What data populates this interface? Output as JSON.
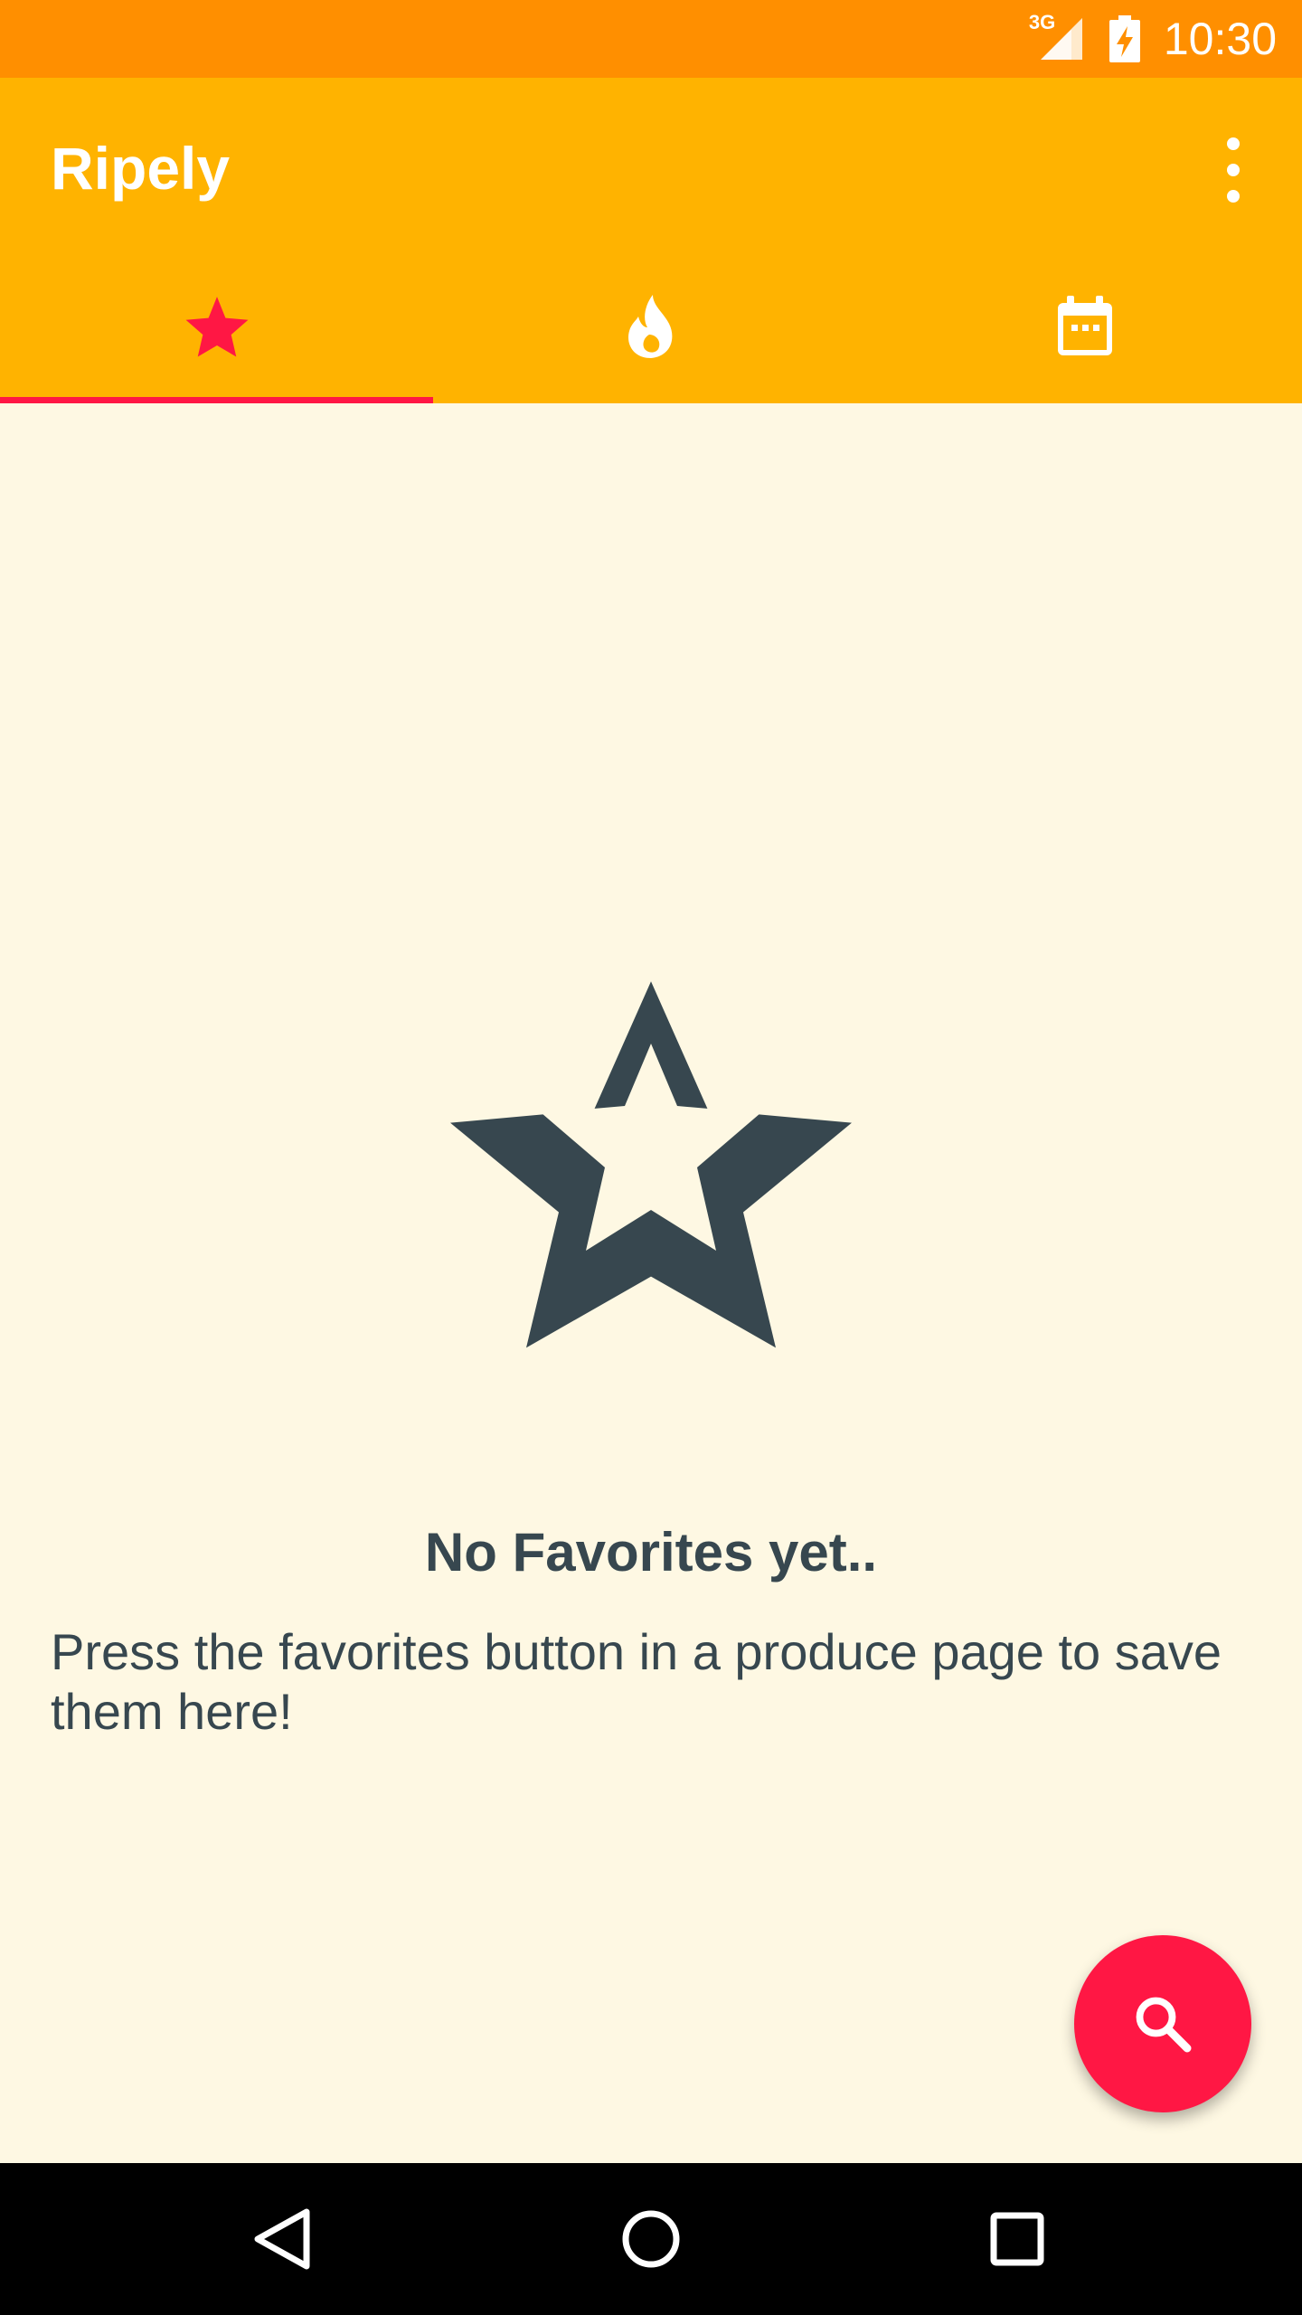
{
  "status_bar": {
    "network_label": "3G",
    "time": "10:30",
    "icons": [
      "signal-icon",
      "battery-charging-icon"
    ]
  },
  "app_bar": {
    "title": "Ripely",
    "menu_icon": "more-vert-icon"
  },
  "tabs": [
    {
      "name": "favorites",
      "icon": "star-icon",
      "selected": true
    },
    {
      "name": "trending",
      "icon": "flame-icon",
      "selected": false
    },
    {
      "name": "calendar",
      "icon": "calendar-icon",
      "selected": false
    }
  ],
  "empty_state": {
    "icon": "star-outline-icon",
    "title": "No Favorites yet..",
    "message": "Press the favorites button in a produce page to save them here!"
  },
  "fab": {
    "icon": "search-icon"
  },
  "nav_bar": {
    "icons": [
      "back-icon",
      "home-icon",
      "recents-icon"
    ]
  },
  "colors": {
    "status_bar": "#FF8F00",
    "app_bar": "#FFB300",
    "accent": "#FF1744",
    "background": "#FEF8E3",
    "text": "#37474F"
  }
}
